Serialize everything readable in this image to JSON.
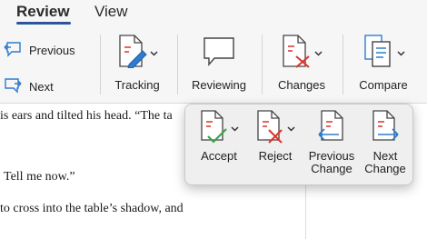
{
  "tabs": [
    {
      "label": "Review",
      "active": true
    },
    {
      "label": "View",
      "active": false
    }
  ],
  "ribbon": {
    "previous_label": "Previous",
    "next_label": "Next",
    "tracking_label": "Tracking",
    "reviewing_label": "Reviewing",
    "changes_label": "Changes",
    "compare_label": "Compare"
  },
  "popup": {
    "accept_label": "Accept",
    "reject_label": "Reject",
    "previous_change_label": "Previous\nChange",
    "next_change_label": "Next\nChange"
  },
  "document": {
    "line1": "is ears and tilted his head. “The ta",
    "line2": "Tell me now.”",
    "line3": "to cross into the table’s shadow, and"
  },
  "colors": {
    "accent": "#2b579a",
    "accept_green": "#3aa34a",
    "reject_red": "#d9342b",
    "nav_blue": "#2e7bcf",
    "doc_red": "#d9342b"
  }
}
